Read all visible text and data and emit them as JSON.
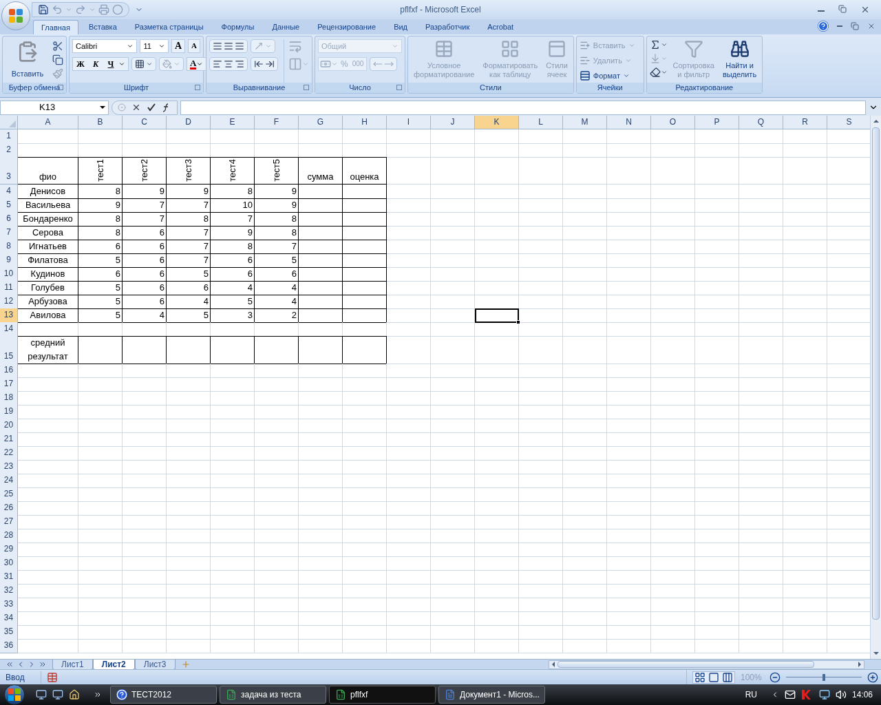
{
  "window": {
    "title": "pflfxf - Microsoft Excel"
  },
  "tabs": [
    {
      "label": "Главная",
      "selected": true
    },
    {
      "label": "Вставка",
      "selected": false
    },
    {
      "label": "Разметка страницы",
      "selected": false
    },
    {
      "label": "Формулы",
      "selected": false
    },
    {
      "label": "Данные",
      "selected": false
    },
    {
      "label": "Рецензирование",
      "selected": false
    },
    {
      "label": "Вид",
      "selected": false
    },
    {
      "label": "Разработчик",
      "selected": false
    },
    {
      "label": "Acrobat",
      "selected": false
    }
  ],
  "ribbon": {
    "groups": [
      {
        "kind": "clipboard",
        "title": "Буфер обмена",
        "paste": "Вставить"
      },
      {
        "kind": "font",
        "title": "Шрифт",
        "font": "Calibri",
        "size": "11",
        "grow": "A",
        "shrink": "A",
        "styles": [
          "Ж",
          "К",
          "Ч"
        ],
        "color_letter": "A"
      },
      {
        "kind": "alignment",
        "title": "Выравнивание"
      },
      {
        "kind": "number",
        "title": "Число",
        "format": "Общий",
        "percent": "%",
        "thousands": "000"
      },
      {
        "kind": "styles",
        "title": "Стили",
        "buttons": [
          {
            "lines": [
              "Условное",
              "форматирование"
            ],
            "disabled": true
          },
          {
            "lines": [
              "Форматировать",
              "как таблицу"
            ],
            "disabled": true
          },
          {
            "lines": [
              "Стили",
              "ячеек"
            ],
            "disabled": true
          }
        ]
      },
      {
        "kind": "cells",
        "title": "Ячейки",
        "buttons": [
          {
            "label": "Вставить",
            "disabled": true
          },
          {
            "label": "Удалить",
            "disabled": true
          },
          {
            "label": "Формат",
            "disabled": false
          }
        ]
      },
      {
        "kind": "editing",
        "title": "Редактирование",
        "buttons": [
          {
            "lines": [
              "Сортировка",
              "и фильтр"
            ],
            "disabled": true
          },
          {
            "lines": [
              "Найти и",
              "выделить"
            ],
            "disabled": false
          }
        ]
      }
    ]
  },
  "formula_bar": {
    "name_box": "K13"
  },
  "columns": [
    {
      "label": "A",
      "selected": false
    },
    {
      "label": "B",
      "selected": false
    },
    {
      "label": "C",
      "selected": false
    },
    {
      "label": "D",
      "selected": false
    },
    {
      "label": "E",
      "selected": false
    },
    {
      "label": "F",
      "selected": false
    },
    {
      "label": "G",
      "selected": false
    },
    {
      "label": "H",
      "selected": false
    },
    {
      "label": "I",
      "selected": false
    },
    {
      "label": "J",
      "selected": false
    },
    {
      "label": "K",
      "selected": true
    },
    {
      "label": "L",
      "selected": false
    },
    {
      "label": "M",
      "selected": false
    },
    {
      "label": "N",
      "selected": false
    },
    {
      "label": "O",
      "selected": false
    },
    {
      "label": "P",
      "selected": false
    },
    {
      "label": "Q",
      "selected": false
    },
    {
      "label": "R",
      "selected": false
    },
    {
      "label": "S",
      "selected": false
    }
  ],
  "rows": [
    {
      "label": "1",
      "kind": "plain",
      "selected": false
    },
    {
      "label": "2",
      "kind": "plain",
      "selected": false
    },
    {
      "label": "3",
      "kind": "header",
      "selected": false,
      "cells": [
        "фио",
        "тест1",
        "тест2",
        "тест3",
        "тест4",
        "тест5",
        "сумма",
        "оценка"
      ]
    },
    {
      "label": "4",
      "kind": "data",
      "selected": false,
      "cells": [
        "Денисов",
        "8",
        "9",
        "9",
        "8",
        "9"
      ]
    },
    {
      "label": "5",
      "kind": "data",
      "selected": false,
      "cells": [
        "Васильева",
        "9",
        "7",
        "7",
        "10",
        "9"
      ]
    },
    {
      "label": "6",
      "kind": "data",
      "selected": false,
      "cells": [
        "Бондаренко",
        "8",
        "7",
        "8",
        "7",
        "8"
      ]
    },
    {
      "label": "7",
      "kind": "data",
      "selected": false,
      "cells": [
        "Серова",
        "8",
        "6",
        "7",
        "9",
        "8"
      ]
    },
    {
      "label": "8",
      "kind": "data",
      "selected": false,
      "cells": [
        "Игнатьев",
        "6",
        "6",
        "7",
        "8",
        "7"
      ]
    },
    {
      "label": "9",
      "kind": "data",
      "selected": false,
      "cells": [
        "Филатова",
        "5",
        "6",
        "7",
        "6",
        "5"
      ]
    },
    {
      "label": "10",
      "kind": "data",
      "selected": false,
      "cells": [
        "Кудинов",
        "6",
        "6",
        "5",
        "6",
        "6"
      ]
    },
    {
      "label": "11",
      "kind": "data",
      "selected": false,
      "cells": [
        "Голубев",
        "5",
        "6",
        "6",
        "4",
        "4"
      ]
    },
    {
      "label": "12",
      "kind": "data",
      "selected": false,
      "cells": [
        "Арбузова",
        "5",
        "6",
        "4",
        "5",
        "4"
      ]
    },
    {
      "label": "13",
      "kind": "data",
      "selected": true,
      "cells": [
        "Авилова",
        "5",
        "4",
        "5",
        "3",
        "2"
      ]
    },
    {
      "label": "14",
      "kind": "plain",
      "selected": false
    },
    {
      "label": "15",
      "kind": "footer",
      "selected": false,
      "cells": [
        "средний результат"
      ]
    },
    {
      "label": "16",
      "kind": "plain",
      "selected": false
    },
    {
      "label": "17",
      "kind": "plain",
      "selected": false
    },
    {
      "label": "18",
      "kind": "plain",
      "selected": false
    },
    {
      "label": "19",
      "kind": "plain",
      "selected": false
    },
    {
      "label": "20",
      "kind": "plain",
      "selected": false
    },
    {
      "label": "21",
      "kind": "plain",
      "selected": false
    },
    {
      "label": "22",
      "kind": "plain",
      "selected": false
    },
    {
      "label": "23",
      "kind": "plain",
      "selected": false
    },
    {
      "label": "24",
      "kind": "plain",
      "selected": false
    },
    {
      "label": "25",
      "kind": "plain",
      "selected": false
    },
    {
      "label": "26",
      "kind": "plain",
      "selected": false
    },
    {
      "label": "27",
      "kind": "plain",
      "selected": false
    },
    {
      "label": "28",
      "kind": "plain",
      "selected": false
    },
    {
      "label": "29",
      "kind": "plain",
      "selected": false
    },
    {
      "label": "30",
      "kind": "plain",
      "selected": false
    },
    {
      "label": "31",
      "kind": "plain",
      "selected": false
    },
    {
      "label": "32",
      "kind": "plain",
      "selected": false
    },
    {
      "label": "33",
      "kind": "plain",
      "selected": false
    },
    {
      "label": "34",
      "kind": "plain",
      "selected": false
    },
    {
      "label": "35",
      "kind": "plain",
      "selected": false
    },
    {
      "label": "36",
      "kind": "plain",
      "selected": false
    }
  ],
  "sheet_tabs": [
    {
      "label": "Лист1",
      "selected": false
    },
    {
      "label": "Лист2",
      "selected": true
    },
    {
      "label": "Лист3",
      "selected": false
    }
  ],
  "status_bar": {
    "mode": "Ввод",
    "zoom": "100%",
    "zoom_slider": {
      "level": 0.5
    }
  },
  "taskbar": {
    "buttons": [
      {
        "label": "TECT2012",
        "kind": "help",
        "selected": false
      },
      {
        "label": "задача из теста",
        "kind": "excel",
        "selected": false
      },
      {
        "label": "pflfxf",
        "kind": "excel",
        "selected": true
      },
      {
        "label": "Документ1 - Micros...",
        "kind": "word",
        "selected": false
      }
    ],
    "language": "RU",
    "clock": "14:06"
  }
}
